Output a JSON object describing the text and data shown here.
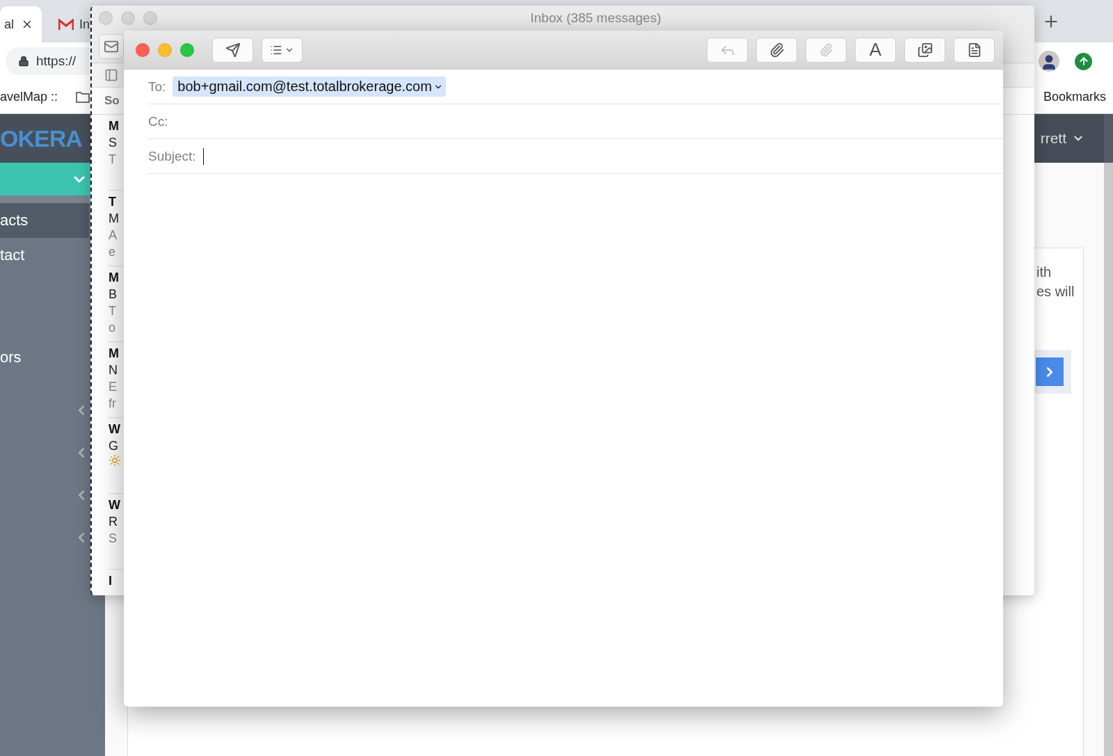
{
  "browser": {
    "tabs": [
      {
        "label": "al",
        "selected": true
      },
      {
        "label": "In",
        "selected": false
      }
    ],
    "address": "https://",
    "bookmarks": [
      "avelMap ::",
      "Bookmarks"
    ]
  },
  "web_page": {
    "logo": "OKERA",
    "user_menu": "rrett",
    "sidebar_items": [
      {
        "label": "acts",
        "selected": true
      },
      {
        "label": "tact",
        "selected": false
      },
      {
        "label": "ors",
        "selected": false
      }
    ],
    "card_text": [
      "ith",
      "es will"
    ]
  },
  "inbox_window": {
    "title": "Inbox (385 messages)",
    "column_header": "So",
    "messages": [
      {
        "lines": [
          "M",
          "S",
          "T"
        ],
        "emoji": false
      },
      {
        "lines": [
          "T",
          "M",
          "A",
          "e"
        ],
        "emoji": false
      },
      {
        "lines": [
          "M",
          "B",
          "T",
          "o"
        ],
        "emoji": false
      },
      {
        "lines": [
          "M",
          "N",
          "E",
          "fr"
        ],
        "emoji": false
      },
      {
        "lines": [
          "W",
          "G"
        ],
        "emoji": true
      },
      {
        "lines": [
          "W",
          "R",
          "S"
        ],
        "emoji": false
      },
      {
        "lines": [
          "I"
        ],
        "emoji": false
      }
    ]
  },
  "compose_window": {
    "fields": [
      {
        "label": "To:",
        "kind": "recipient",
        "value": "bob+gmail.com@test.totalbrokerage.com"
      },
      {
        "label": "Cc:",
        "kind": "plain"
      },
      {
        "label": "Subject:",
        "kind": "cursor"
      }
    ],
    "toolbar": [
      {
        "kind": "reply",
        "disabled": true
      },
      {
        "kind": "attach",
        "disabled": false
      },
      {
        "kind": "markup",
        "disabled": true
      },
      {
        "kind": "format",
        "label": "A",
        "disabled": false
      },
      {
        "kind": "photo",
        "disabled": false
      },
      {
        "kind": "stationery",
        "disabled": false
      }
    ]
  }
}
